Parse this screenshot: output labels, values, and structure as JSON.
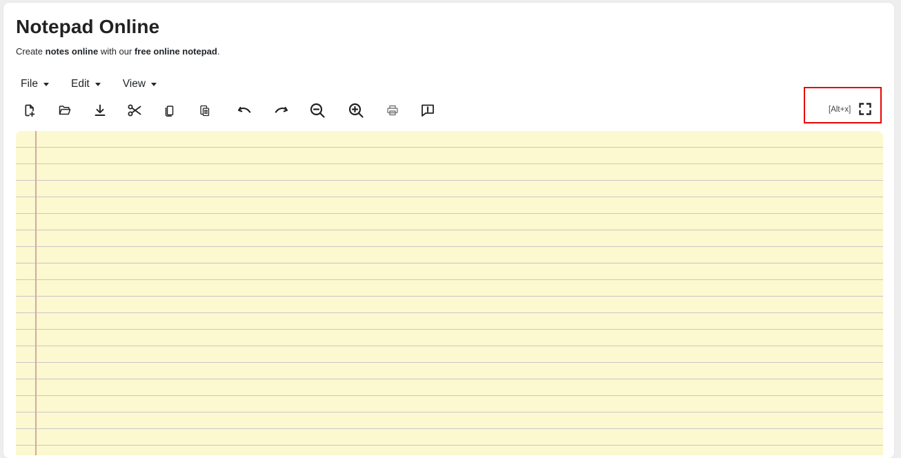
{
  "header": {
    "title": "Notepad Online",
    "subtitle": {
      "part1": "Create ",
      "part2": "notes online",
      "part3": " with our ",
      "part4": "free online notepad",
      "part5": "."
    }
  },
  "menubar": {
    "items": [
      {
        "label": "File"
      },
      {
        "label": "Edit"
      },
      {
        "label": "View"
      }
    ]
  },
  "toolbar": {
    "buttons": [
      {
        "icon": "new-file-icon"
      },
      {
        "icon": "open-folder-icon"
      },
      {
        "icon": "download-icon"
      },
      {
        "icon": "cut-icon"
      },
      {
        "icon": "copy-icon"
      },
      {
        "icon": "paste-icon"
      },
      {
        "icon": "undo-icon"
      },
      {
        "icon": "redo-icon"
      },
      {
        "icon": "zoom-out-icon"
      },
      {
        "icon": "zoom-in-icon"
      },
      {
        "icon": "print-icon"
      },
      {
        "icon": "feedback-icon"
      }
    ],
    "fullscreen_hint": "[Alt+x]",
    "fullscreen_icon": "fullscreen-icon"
  },
  "editor": {
    "content": "",
    "paper_color": "#fcf8d0",
    "line_color": "#c9c7c7",
    "margin_color": "#d2a8a0"
  },
  "colors": {
    "highlight_border": "#e60000"
  }
}
